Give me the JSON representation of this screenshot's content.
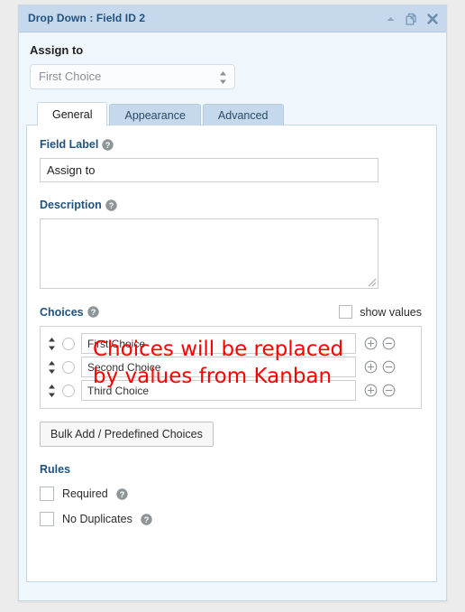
{
  "panel": {
    "title": "Drop Down : Field ID 2",
    "header_icons": [
      {
        "name": "collapse-icon",
        "label": "Collapse"
      },
      {
        "name": "duplicate-icon",
        "label": "Duplicate"
      },
      {
        "name": "close-icon",
        "label": "Close"
      }
    ],
    "colors": {
      "header_bg": "#c6d9ec",
      "header_text": "#21527d",
      "panel_bg": "#f0f7fc",
      "panel_border": "#c9d8e6",
      "section_label": "#21527d",
      "annotation": "#ff0000",
      "page_bg": "#ececec"
    }
  },
  "assign": {
    "label": "Assign to",
    "select_value": "First Choice",
    "options": [
      "First Choice",
      "Second Choice",
      "Third Choice"
    ]
  },
  "tabs": [
    {
      "label": "General",
      "active": true
    },
    {
      "label": "Appearance",
      "active": false
    },
    {
      "label": "Advanced",
      "active": false
    }
  ],
  "general": {
    "field_label": {
      "label": "Field Label",
      "value": "Assign to",
      "placeholder": ""
    },
    "description": {
      "label": "Description",
      "value": "",
      "placeholder": ""
    },
    "choices": {
      "label": "Choices",
      "show_values_label": "show values",
      "show_values_checked": false,
      "rows": [
        {
          "value": "First Choice",
          "selected": false
        },
        {
          "value": "Second Choice",
          "selected": false
        },
        {
          "value": "Third Choice",
          "selected": false
        }
      ],
      "row_add_label": "Add choice",
      "row_remove_label": "Remove choice"
    },
    "annotation": {
      "line1": "Choices will be replaced",
      "line2": "by values from Kanban"
    },
    "bulk_button": "Bulk Add / Predefined Choices",
    "rules": {
      "label": "Rules",
      "items": [
        {
          "label": "Required",
          "checked": false
        },
        {
          "label": "No Duplicates",
          "checked": false
        }
      ]
    }
  }
}
